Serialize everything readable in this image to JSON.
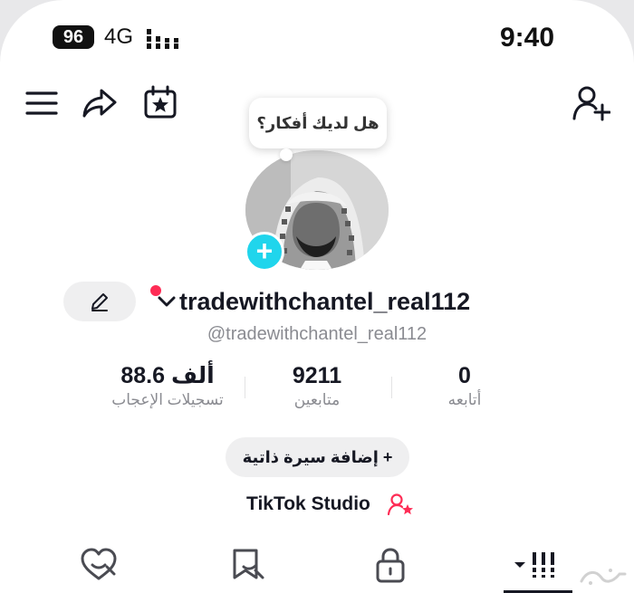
{
  "status_bar": {
    "battery": "96",
    "network": "4G",
    "time": "9:40"
  },
  "top_nav": {
    "icons": [
      "menu-icon",
      "share-icon",
      "calendar-star-icon",
      "add-friend-icon"
    ]
  },
  "profile": {
    "thought_bubble": "هل لديك أفكار؟",
    "username": "tradewithchantel_real112",
    "handle": "@tradewithchantel_real112"
  },
  "stats": {
    "likes": {
      "value": "88.6 ألف",
      "label": "تسجيلات الإعجاب"
    },
    "followers": {
      "value": "9211",
      "label": "متابعين"
    },
    "following": {
      "value": "0",
      "label": "أتابعه"
    }
  },
  "actions": {
    "add_bio": "إضافة سيرة ذاتية",
    "add_bio_icon": "+",
    "studio": "TikTok Studio",
    "add_avatar": "+"
  },
  "tabs": [
    "videos-grid-icon",
    "private-lock-icon",
    "favorites-icon",
    "liked-icon"
  ],
  "colors": {
    "accent_cyan": "#20d5ec",
    "accent_red": "#fe2c55",
    "text_primary": "#161823",
    "text_secondary": "#8a8b91"
  }
}
